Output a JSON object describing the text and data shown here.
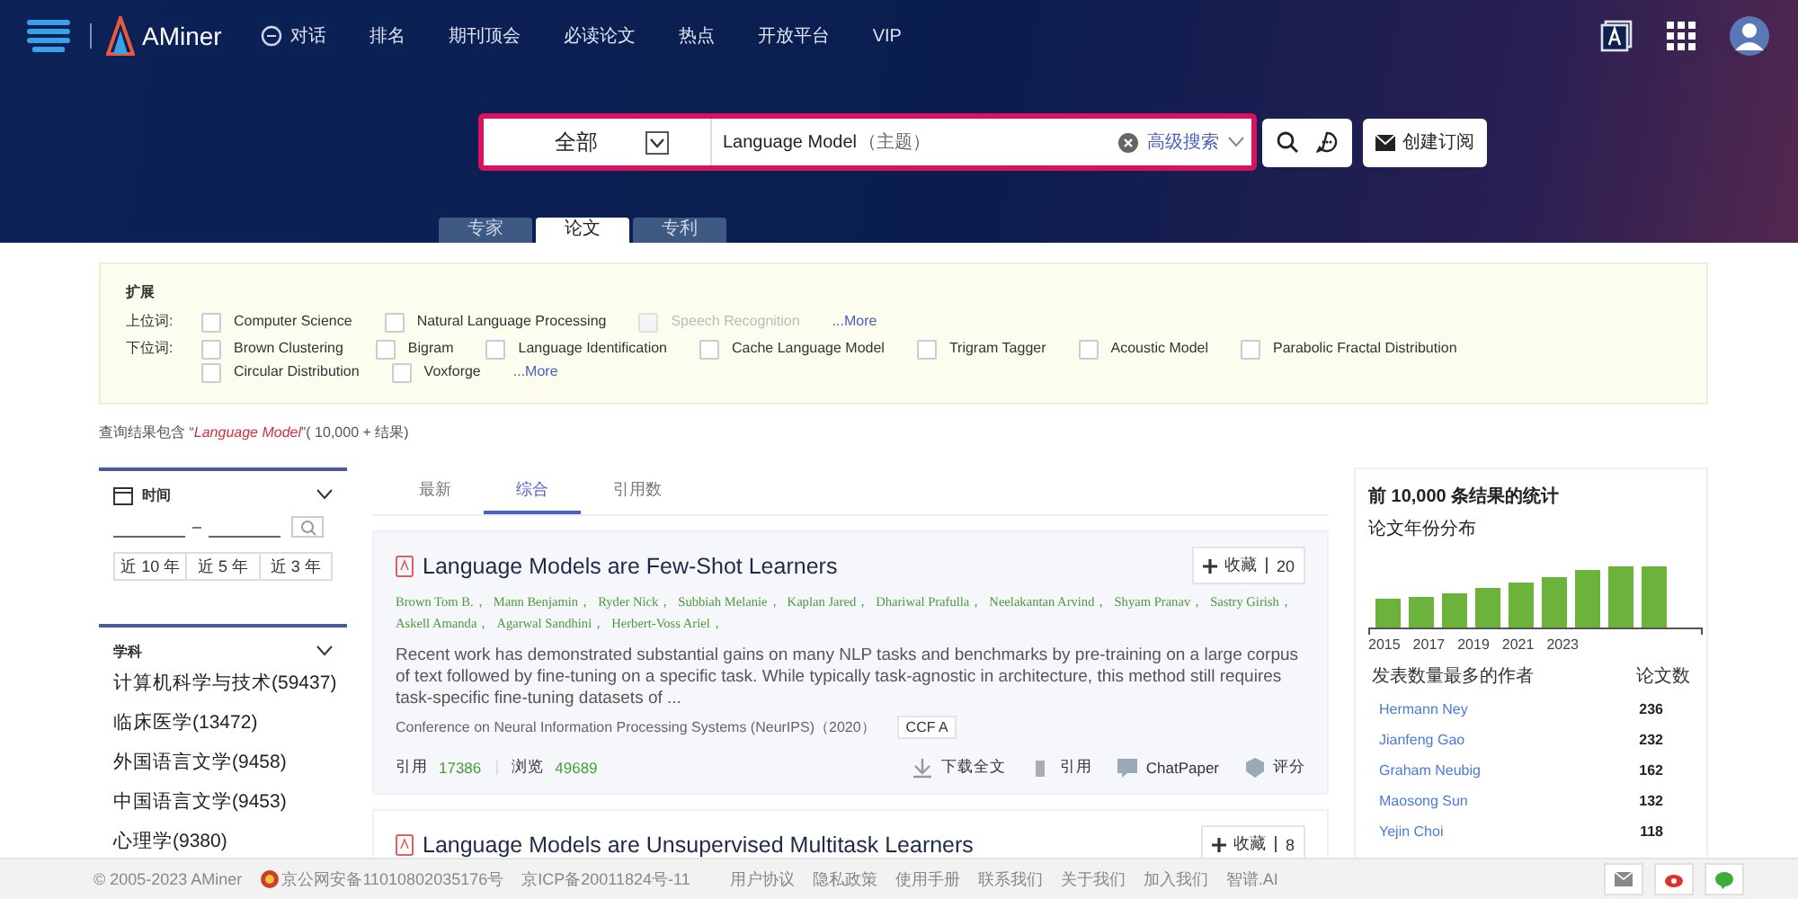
{
  "brand": {
    "name": "AMiner"
  },
  "nav_items": [
    {
      "label": "对话",
      "kind": "chat"
    },
    {
      "label": "排名",
      "kind": "plain"
    },
    {
      "label": "期刊顶会",
      "kind": "plain"
    },
    {
      "label": "必读论文",
      "kind": "plain"
    },
    {
      "label": "热点",
      "kind": "plain"
    },
    {
      "label": "开放平台",
      "kind": "plain"
    },
    {
      "label": "VIP",
      "kind": "plain"
    }
  ],
  "search": {
    "scope": "全部",
    "query": "Language Model",
    "query_tag": "（主题）",
    "advanced": "高级搜索",
    "subscribe": "创建订阅"
  },
  "search_tabs": [
    {
      "label": "专家",
      "selected": false
    },
    {
      "label": "论文",
      "selected": true
    },
    {
      "label": "专利",
      "selected": false
    }
  ],
  "expand": {
    "title": "扩展",
    "rows": [
      {
        "label": "上位词:",
        "terms": [
          {
            "label": "Computer Science",
            "checked": false,
            "disabled": false
          },
          {
            "label": "Natural Language Processing",
            "checked": false,
            "disabled": false
          },
          {
            "label": "Speech Recognition",
            "checked": false,
            "disabled": true
          }
        ],
        "more": "...More"
      },
      {
        "label": "下位词:",
        "terms": [
          {
            "label": "Brown Clustering",
            "checked": false,
            "disabled": false
          },
          {
            "label": "Bigram",
            "checked": false,
            "disabled": false
          },
          {
            "label": "Language Identification",
            "checked": false,
            "disabled": false
          },
          {
            "label": "Cache Language Model",
            "checked": false,
            "disabled": false
          },
          {
            "label": "Trigram Tagger",
            "checked": false,
            "disabled": false
          },
          {
            "label": "Acoustic Model",
            "checked": false,
            "disabled": false
          },
          {
            "label": "Parabolic Fractal Distribution",
            "checked": false,
            "disabled": false
          },
          {
            "label": "Circular Distribution",
            "checked": false,
            "disabled": false
          },
          {
            "label": "Voxforge",
            "checked": false,
            "disabled": false
          }
        ],
        "more": "...More"
      }
    ]
  },
  "result_summary": "查询结果包含 “*Language Model*”( 10,000 + 结果)",
  "time_filter": {
    "title": "时间",
    "ranges": [
      "近 10 年",
      "近 5 年",
      "近 3 年"
    ]
  },
  "subject_filter": {
    "title": "学科",
    "items": [
      "计算机科学与技术(59437)",
      "临床医学(13472)",
      "外国语言文学(9458)",
      "中国语言文学(9453)",
      "心理学(9380)"
    ]
  },
  "sort_tabs": [
    {
      "label": "最新",
      "selected": false
    },
    {
      "label": "综合",
      "selected": true
    },
    {
      "label": "引用数",
      "selected": false
    }
  ],
  "papers": [
    {
      "title": "Language Models are Few-Shot Learners",
      "collect": "收藏",
      "collect_count": "20",
      "authors": [
        "Brown Tom B.，",
        "Mann Benjamin，",
        "Ryder Nick，",
        "Subbiah Melanie，",
        "Kaplan Jared，",
        "Dhariwal Prafulla，",
        "Neelakantan Arvind，",
        "Shyam Pranav，",
        "Sastry Girish，",
        "Askell Amanda，",
        "Agarwal Sandhini，",
        "Herbert-Voss Ariel，"
      ],
      "abstract": "Recent work has demonstrated substantial gains on many NLP tasks and benchmarks by pre-training on a large corpus of text followed by fine-tuning on a specific task. While typically task-agnostic in architecture, this method still requires task-specific fine-tuning datasets of ...",
      "venue": "Conference on Neural Information Processing Systems (NeurIPS)（2020）",
      "rank": "CCF A",
      "cite_label": "引用",
      "citations": "17386",
      "view_label": "浏览",
      "views": "49689",
      "actions": [
        {
          "label": "下载全文",
          "kind": "download"
        },
        {
          "label": "引用",
          "kind": "cite"
        },
        {
          "label": "ChatPaper",
          "kind": "chat"
        },
        {
          "label": "评分",
          "kind": "rate"
        }
      ]
    },
    {
      "title": "Language Models are Unsupervised Multitask Learners",
      "collect": "收藏",
      "collect_count": "8"
    }
  ],
  "stats": {
    "title": "前 10,000 条结果的统计",
    "subtitle": "论文年份分布",
    "year_labels": [
      "2015",
      "2017",
      "2019",
      "2021",
      "2023"
    ],
    "author_header": "发表数量最多的作者",
    "count_header": "论文数",
    "authors": [
      {
        "name": "Hermann Ney",
        "count": "236"
      },
      {
        "name": "Jianfeng Gao",
        "count": "232"
      },
      {
        "name": "Graham Neubig",
        "count": "162"
      },
      {
        "name": "Maosong Sun",
        "count": "132"
      },
      {
        "name": "Yejin Choi",
        "count": "118"
      }
    ]
  },
  "footer": {
    "copyright": "© 2005-2023 AMiner",
    "police": "京公网安备11010802035176号",
    "icp": "京ICP备20011824号-11",
    "links": [
      "用户协议",
      "隐私政策",
      "使用手册",
      "联系我们",
      "关于我们",
      "加入我们",
      "智谱.AI"
    ]
  }
}
